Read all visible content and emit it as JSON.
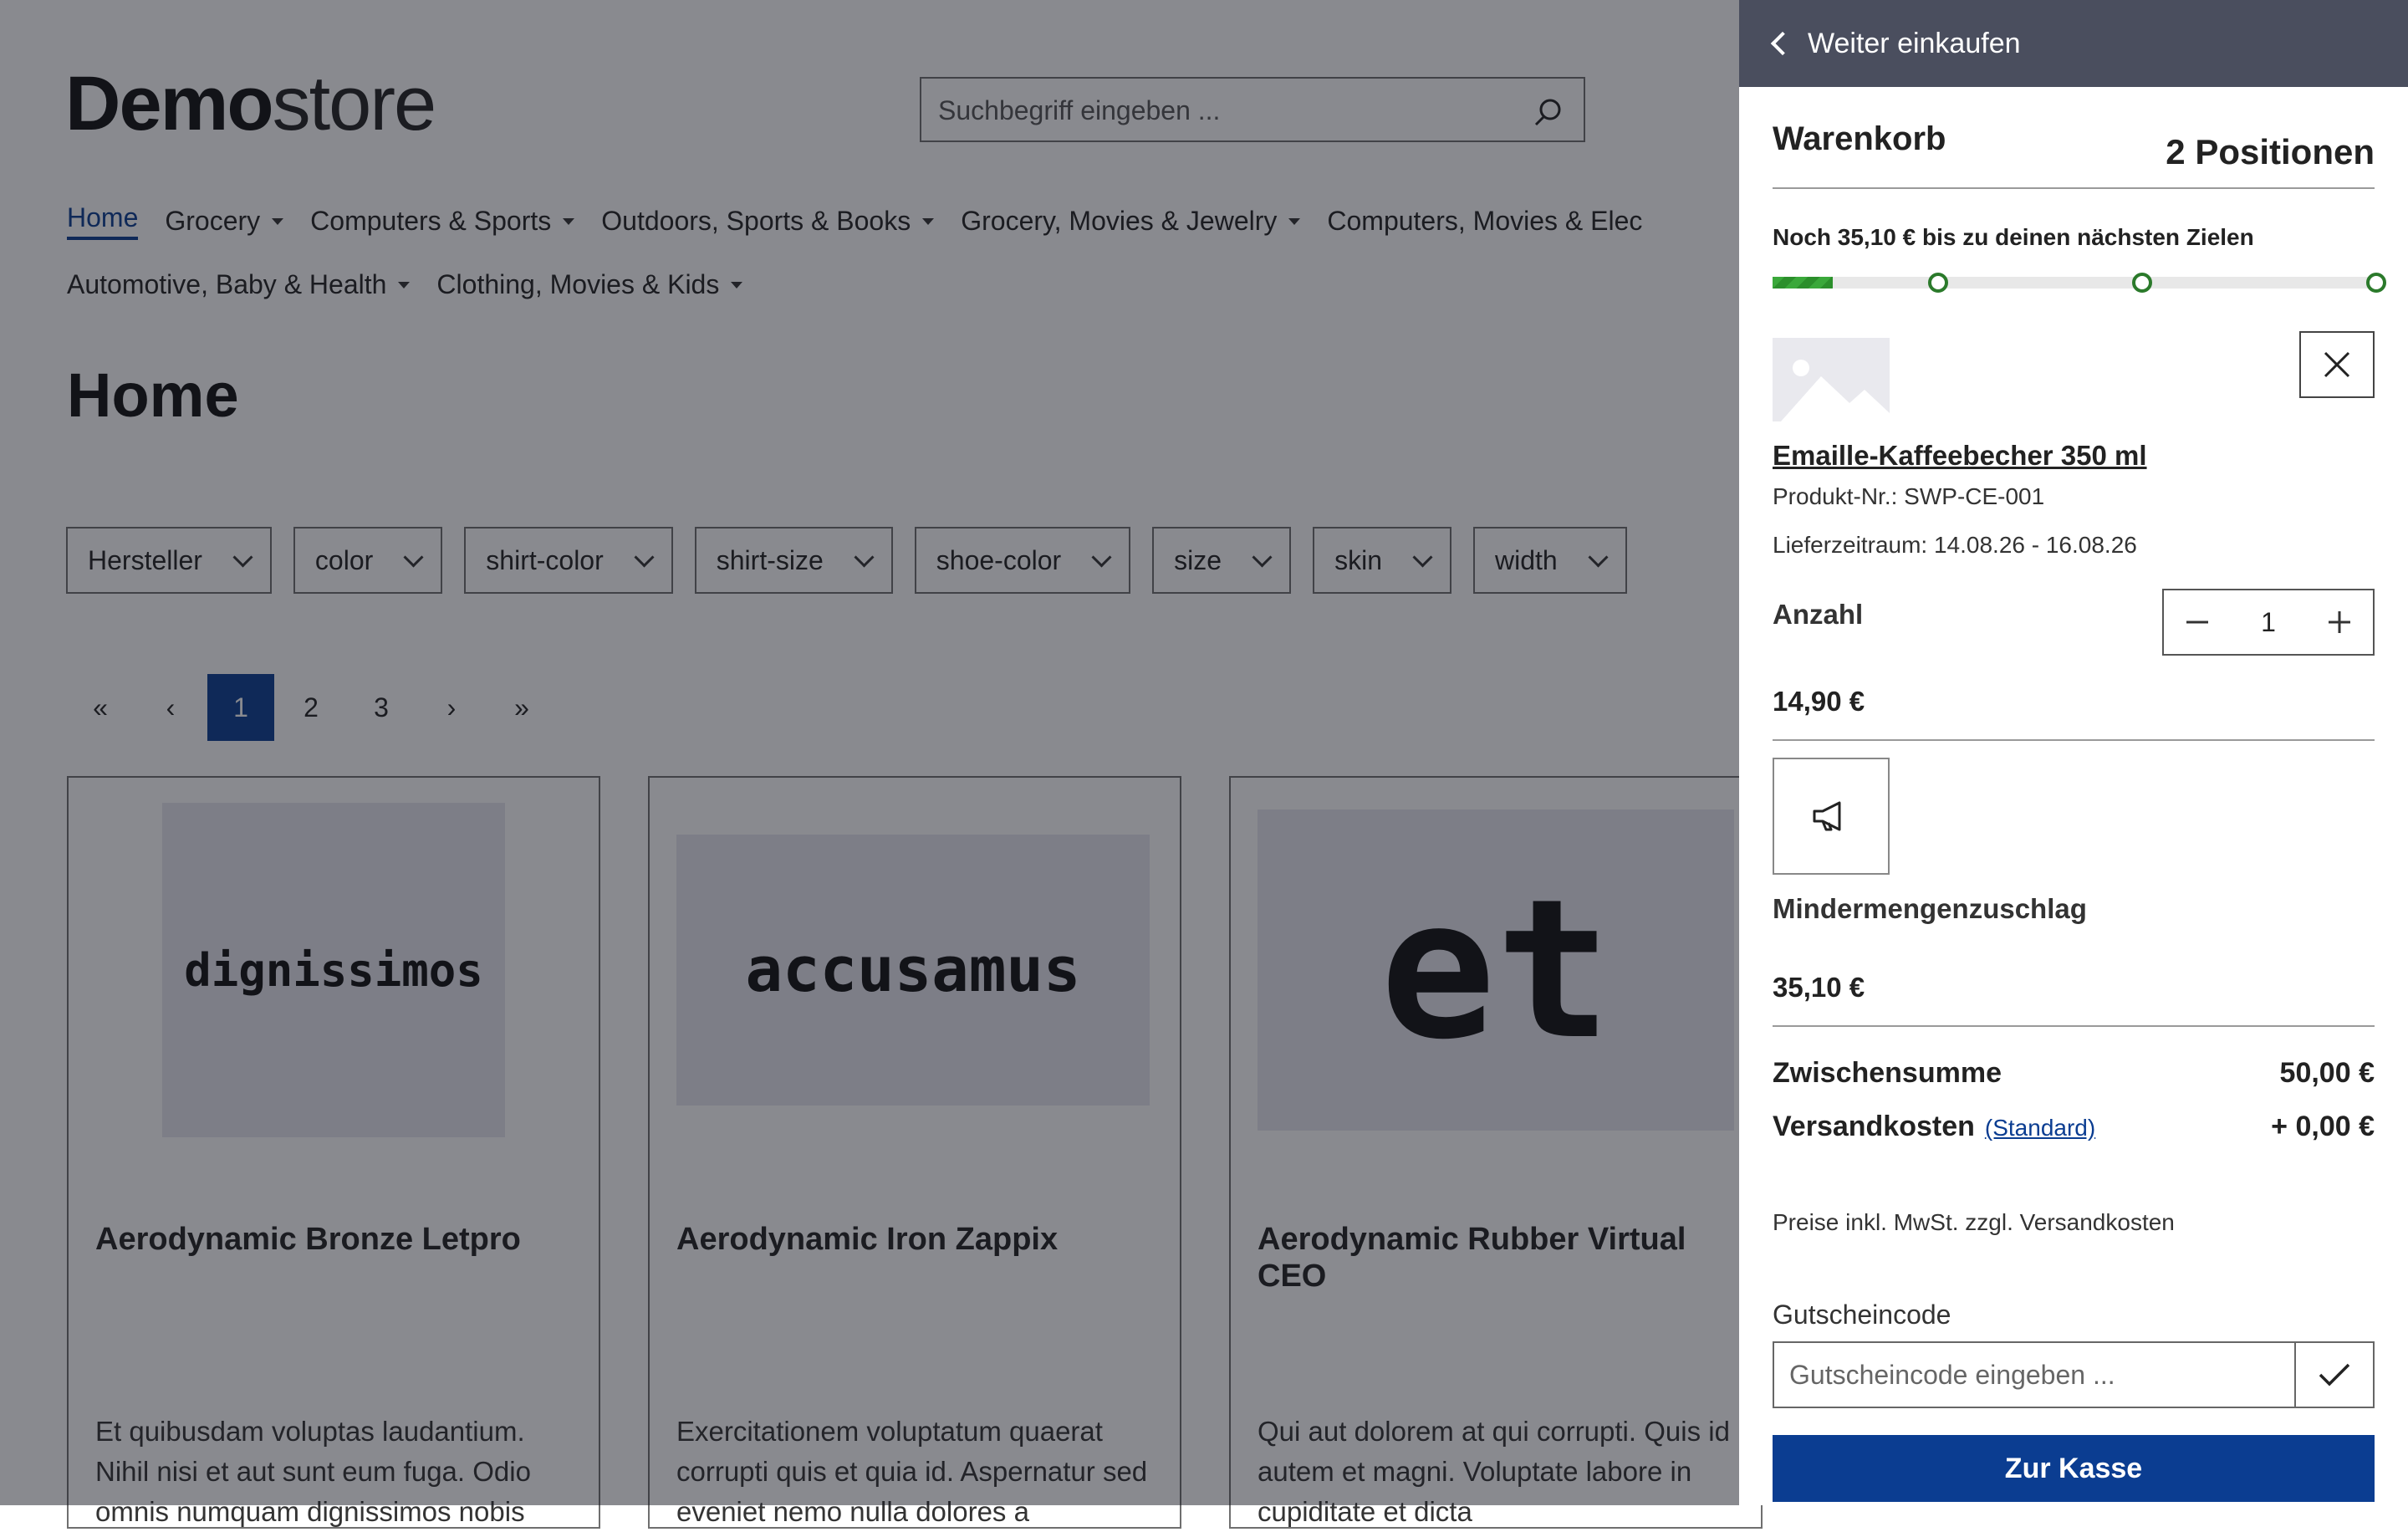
{
  "logo": {
    "bold": "Demo",
    "light": "store"
  },
  "search": {
    "placeholder": "Suchbegriff eingeben ..."
  },
  "nav": {
    "row1": [
      "Home",
      "Grocery",
      "Computers & Sports",
      "Outdoors, Sports & Books",
      "Grocery, Movies & Jewelry",
      "Computers, Movies & Elec"
    ],
    "row2": [
      "Automotive, Baby & Health",
      "Clothing, Movies & Kids"
    ]
  },
  "page_title": "Home",
  "filters": [
    "Hersteller",
    "color",
    "shirt-color",
    "shirt-size",
    "shoe-color",
    "size",
    "skin",
    "width"
  ],
  "pagination": {
    "first": "«",
    "prev": "‹",
    "pages": [
      "1",
      "2",
      "3"
    ],
    "next": "›",
    "last": "»",
    "active": "1"
  },
  "products": [
    {
      "image_text": "dignissimos",
      "name": "Aerodynamic Bronze Letpro",
      "desc": "Et quibusdam voluptas laudantium. Nihil nisi et aut sunt eum fuga. Odio omnis numquam dignissimos nobis"
    },
    {
      "image_text": "accusamus",
      "name": "Aerodynamic Iron Zappix",
      "desc": "Exercitationem voluptatum quaerat corrupti quis et quia id. Aspernatur sed eveniet nemo nulla dolores a"
    },
    {
      "image_text": "et",
      "name": "Aerodynamic Rubber Virtual CEO",
      "desc": "Qui aut dolorem at qui corrupti. Quis id autem et magni. Voluptate labore in cupiditate et dicta"
    }
  ],
  "cart": {
    "back_label": "Weiter einkaufen",
    "title": "Warenkorb",
    "count": "2 Positionen",
    "goal_text": "Noch 35,10 € bis zu deinen nächsten Zielen",
    "progress_percent": 10,
    "item": {
      "name": "Emaille-Kaffeebecher 350 ml",
      "sku": "Produkt-Nr.: SWP-CE-001",
      "delivery": "Lieferzeitraum: 14.08.26 - 16.08.26",
      "qty_label": "Anzahl",
      "qty": "1",
      "price": "14,90 €"
    },
    "surcharge": {
      "name": "Mindermengenzuschlag",
      "price": "35,10 €"
    },
    "subtotal_label": "Zwischensumme",
    "subtotal": "50,00 €",
    "shipping_label": "Versandkosten",
    "shipping_method": "(Standard)",
    "shipping": "+ 0,00 €",
    "tax_note": "Preise inkl. MwSt. zzgl. Versandkosten",
    "coupon_label": "Gutscheincode",
    "coupon_placeholder": "Gutscheincode eingeben ...",
    "checkout_label": "Zur Kasse"
  },
  "colors": {
    "primary": "#0b3d91",
    "header_bg": "#4a4e5e",
    "progress": "#3aa83a"
  }
}
